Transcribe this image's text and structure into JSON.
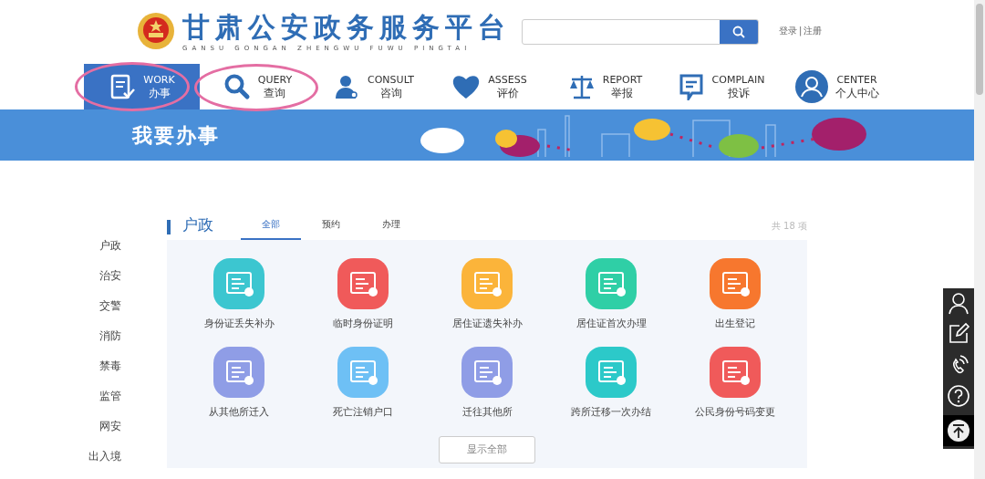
{
  "header": {
    "title": "甘肃公安政务服务平台",
    "subtitle": "GANSU GONGAN ZHENGWU FUWU PINGTAI",
    "login": "登录",
    "register": "注册",
    "separator": "|"
  },
  "nav": [
    {
      "en": "WORK",
      "zh": "办事",
      "kind": "work",
      "selected": true
    },
    {
      "en": "QUERY",
      "zh": "查询",
      "kind": "query",
      "selected": false
    },
    {
      "en": "CONSULT",
      "zh": "咨询",
      "kind": "consult",
      "selected": false
    },
    {
      "en": "ASSESS",
      "zh": "评价",
      "kind": "assess",
      "selected": false
    },
    {
      "en": "REPORT",
      "zh": "举报",
      "kind": "report",
      "selected": false
    },
    {
      "en": "COMPLAIN",
      "zh": "投诉",
      "kind": "complain",
      "selected": false
    },
    {
      "en": "CENTER",
      "zh": "个人中心",
      "kind": "center",
      "selected": false
    }
  ],
  "banner": {
    "title": "我要办事"
  },
  "sidebar": {
    "items": [
      {
        "label": "户政"
      },
      {
        "label": "治安"
      },
      {
        "label": "交警"
      },
      {
        "label": "消防"
      },
      {
        "label": "禁毒"
      },
      {
        "label": "监管"
      },
      {
        "label": "网安"
      },
      {
        "label": "出入境"
      }
    ]
  },
  "section": {
    "title": "户政",
    "tabs": [
      {
        "label": "全部",
        "selected": true
      },
      {
        "label": "预约",
        "selected": false
      },
      {
        "label": "办理",
        "selected": false
      }
    ],
    "count": "共 18 项",
    "services": [
      {
        "label": "身份证丢失补办",
        "color": "#3cc6d0"
      },
      {
        "label": "临时身份证明",
        "color": "#f05a5a"
      },
      {
        "label": "居住证遗失补办",
        "color": "#fbb43a"
      },
      {
        "label": "居住证首次办理",
        "color": "#2fcfa6"
      },
      {
        "label": "出生登记",
        "color": "#f7772e"
      },
      {
        "label": "从其他所迁入",
        "color": "#8f9de6"
      },
      {
        "label": "死亡注销户口",
        "color": "#6ec0f5"
      },
      {
        "label": "迁往其他所",
        "color": "#8f9de6"
      },
      {
        "label": "跨所迁移一次办结",
        "color": "#2cc9c9"
      },
      {
        "label": "公民身份号码变更",
        "color": "#f05a5a"
      }
    ],
    "show_all": "显示全部"
  }
}
